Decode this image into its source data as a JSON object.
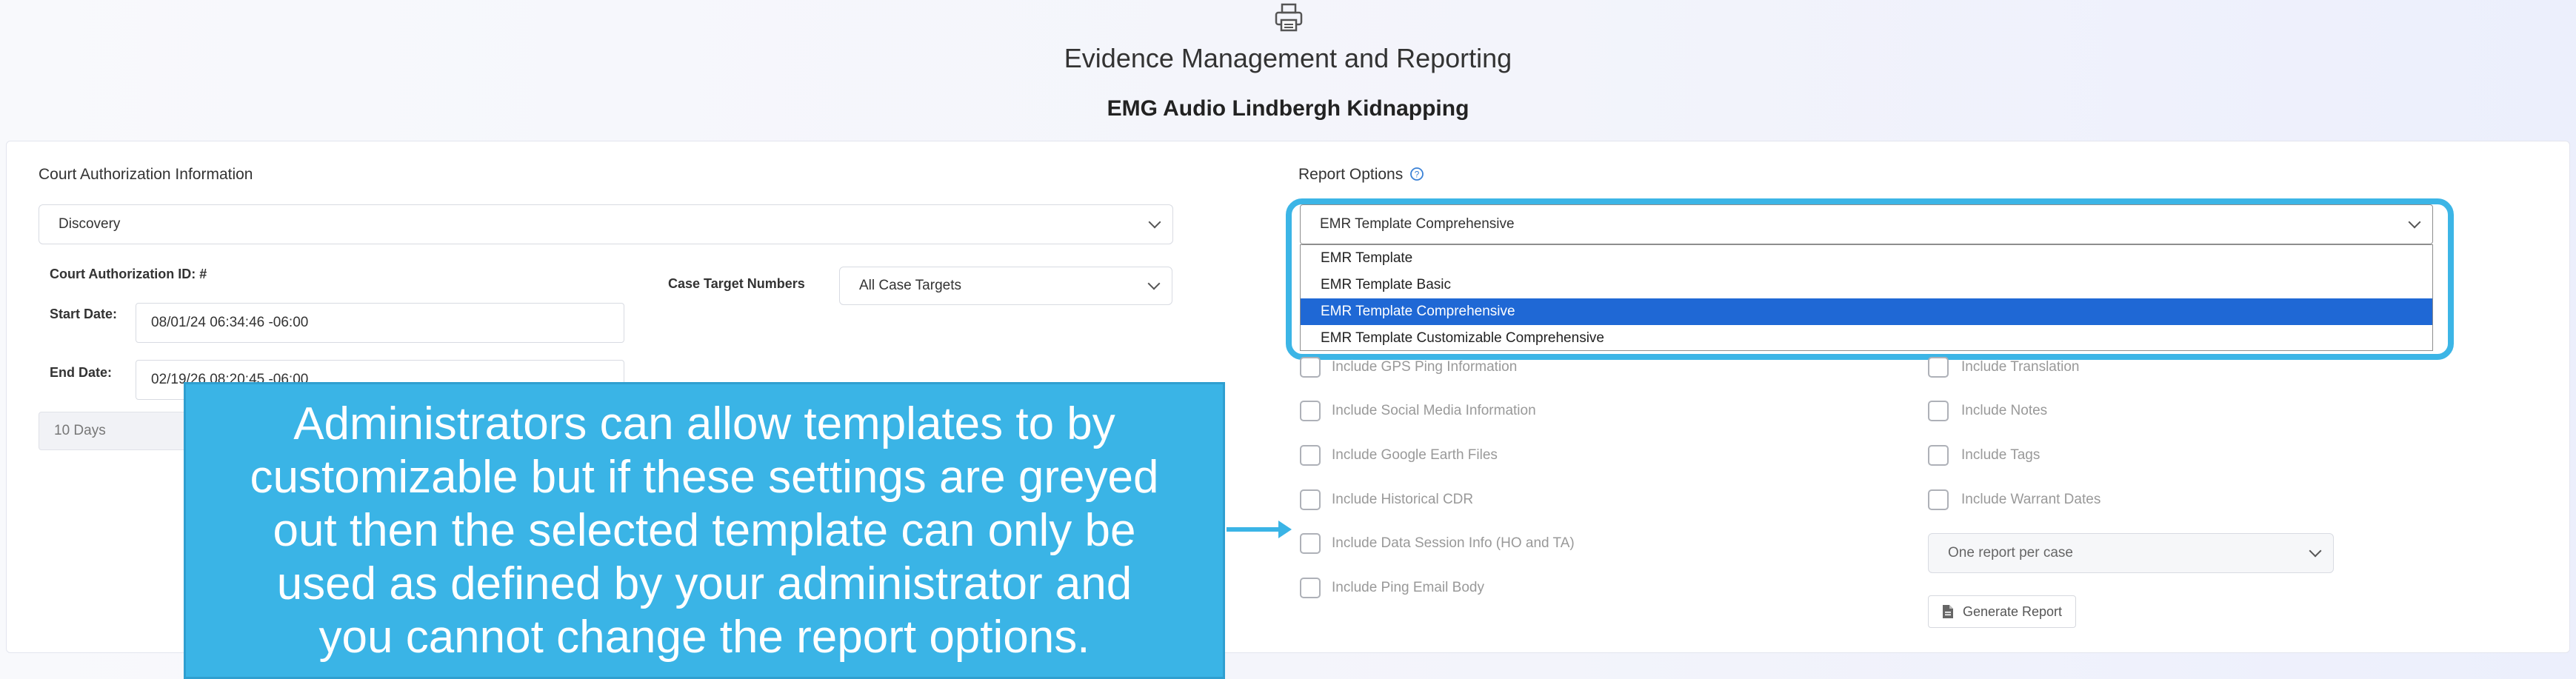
{
  "header": {
    "print_icon": "printer-icon",
    "title": "Evidence Management and Reporting",
    "subtitle": "EMG Audio Lindbergh Kidnapping"
  },
  "court_auth": {
    "section_title": "Court Authorization Information",
    "selected": "Discovery",
    "id_label": "Court Authorization ID: #",
    "start_label": "Start Date:",
    "start_value": "08/01/24 06:34:46 -06:00",
    "end_label": "End Date:",
    "end_value": "02/19/26 08:20:45 -06:00",
    "duration": "10 Days",
    "case_targets_label": "Case Target Numbers",
    "case_targets_value": "All Case Targets"
  },
  "report_options": {
    "section_title": "Report Options",
    "help_icon": "question-circle-icon",
    "selected_template": "EMR Template Comprehensive",
    "template_options": [
      {
        "label": "EMR Template",
        "selected": false
      },
      {
        "label": "EMR Template Basic",
        "selected": false
      },
      {
        "label": "EMR Template Comprehensive",
        "selected": true
      },
      {
        "label": "EMR Template Customizable Comprehensive",
        "selected": false
      }
    ],
    "left_checkboxes": [
      "Include GPS Ping Information",
      "Include Social Media Information",
      "Include Google Earth Files",
      "Include Historical CDR",
      "Include Data Session Info (HO and TA)",
      "Include Ping Email Body"
    ],
    "right_checkboxes": [
      "Include Translation",
      "Include Notes",
      "Include Tags",
      "Include Warrant Dates"
    ],
    "report_mode": "One report per case",
    "generate_label": "Generate Report",
    "generate_icon": "document-icon"
  },
  "callout": {
    "lines": [
      "Administrators can allow templates to by",
      "customizable but if these settings are greyed",
      "out then the selected template can only be",
      "used as defined by your administrator and",
      "you cannot change the report options."
    ]
  },
  "colors": {
    "callout_bg": "#3ab4e6",
    "focus_ring": "#3cb5e6",
    "selected_option": "#1f68d5"
  }
}
